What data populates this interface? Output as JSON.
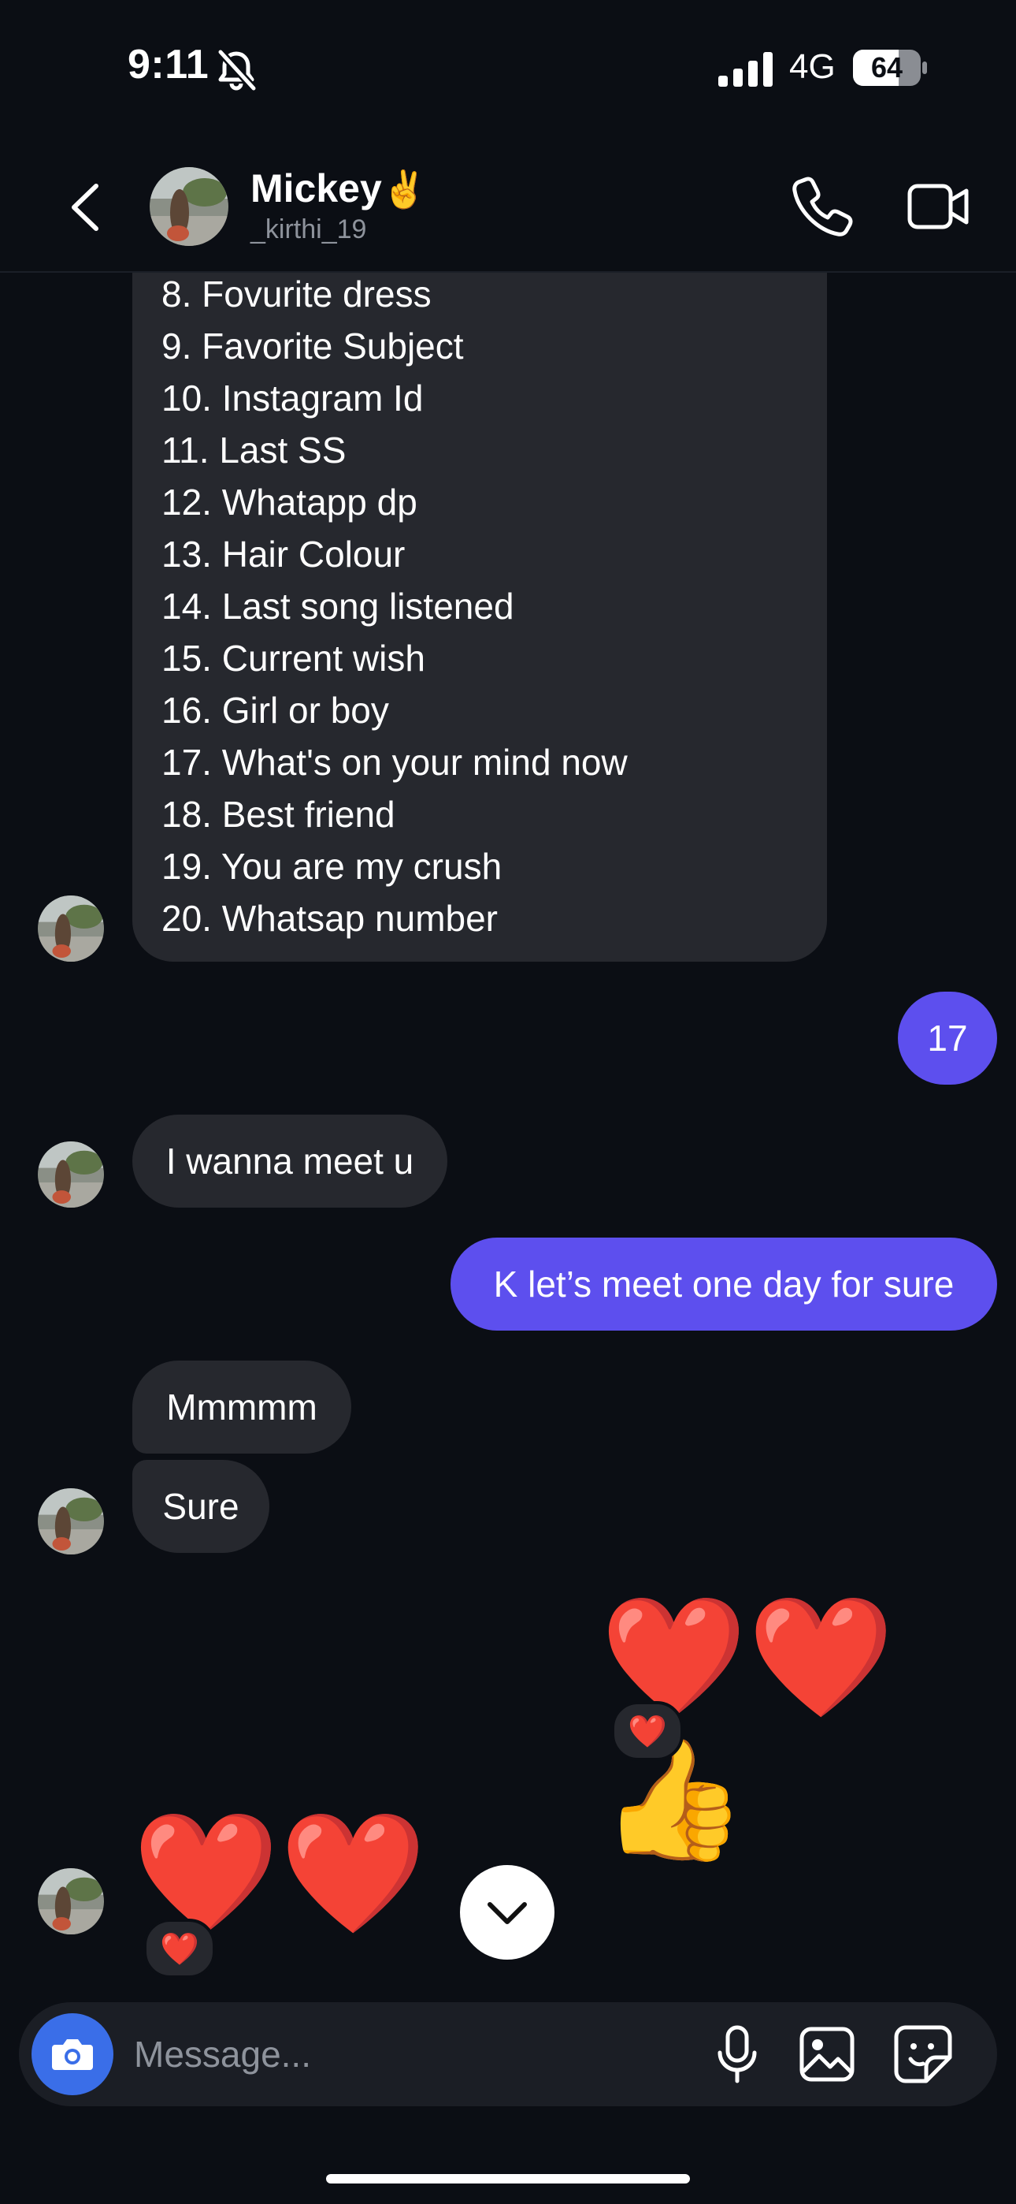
{
  "status_bar": {
    "time": "9:11",
    "network": "4G",
    "battery": "64"
  },
  "header": {
    "name": "Mickey",
    "name_emoji": "✌️",
    "username": "_kirthi_19"
  },
  "list_items": [
    "8. Fovurite dress",
    "9. Favorite Subject",
    "10. Instagram Id",
    "11. Last SS",
    "12. Whatapp dp",
    "13. Hair Colour",
    "14. Last song listened",
    "15. Current wish",
    "16. Girl or boy",
    "17. What's on your mind now",
    "18. Best friend",
    "19. You are my crush",
    "20. Whatsap number"
  ],
  "messages": {
    "sent_17": "17",
    "received_meet": "I wanna meet u",
    "sent_meet": "K let’s meet one day for sure",
    "received_mmm": "Mmmmm",
    "received_sure": "Sure",
    "sent_emojis": "❤️❤️👍",
    "sent_reaction": "❤️",
    "received_emojis": "❤️❤️",
    "received_reaction": "❤️"
  },
  "composer": {
    "placeholder": "Message..."
  },
  "colors": {
    "sent_bubble": "#5d4fee",
    "received_bubble": "#26282e",
    "background": "#0b0e14",
    "camera_button": "#3a6ee8"
  }
}
